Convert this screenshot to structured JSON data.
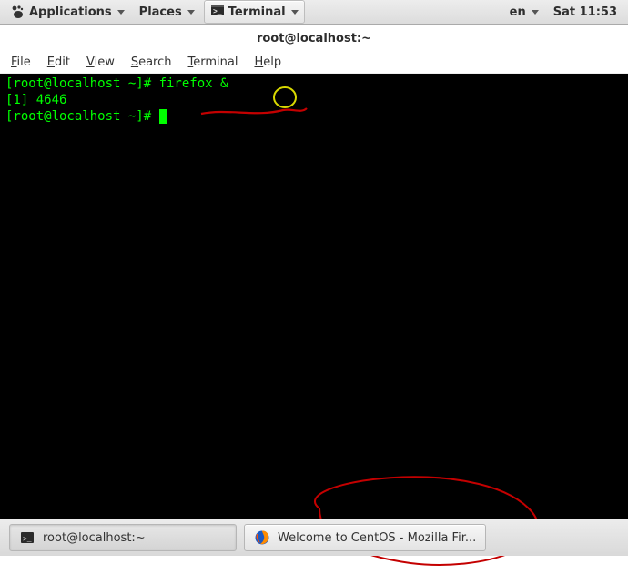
{
  "top_panel": {
    "applications": "Applications",
    "places": "Places",
    "app_name": "Terminal",
    "lang": "en",
    "clock": "Sat 11:53"
  },
  "terminal": {
    "title": "root@localhost:~",
    "menu": {
      "file": "File",
      "edit": "Edit",
      "view": "View",
      "search": "Search",
      "terminal": "Terminal",
      "help": "Help"
    },
    "lines": {
      "l1_prompt": "[root@localhost ~]# ",
      "l1_cmd": "firefox &",
      "l2": "[1] 4646",
      "l3_prompt": "[root@localhost ~]# "
    }
  },
  "taskbar": {
    "t1_label": "root@localhost:~",
    "t2_label": "Welcome to CentOS - Mozilla Fir..."
  },
  "icons": {
    "terminal": "terminal-icon",
    "firefox": "firefox-icon",
    "foot": "gnome-foot-icon"
  }
}
